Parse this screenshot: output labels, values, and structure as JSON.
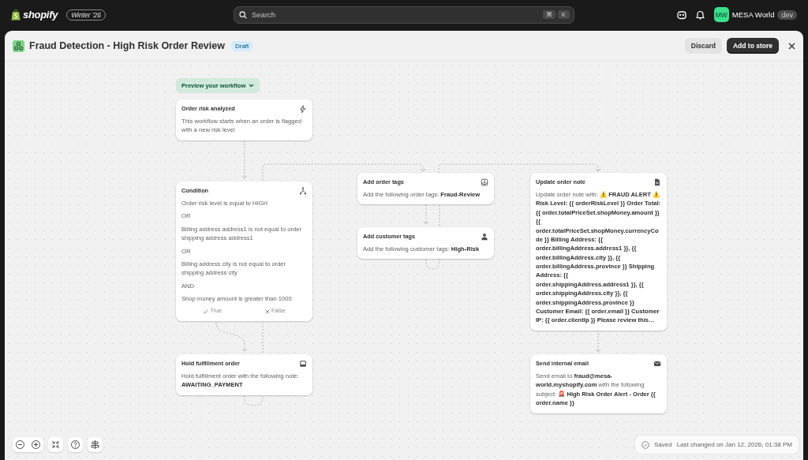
{
  "app": {
    "brand": "shopify",
    "edition": "Winter '26",
    "search": {
      "placeholder": "Search",
      "keys": [
        "⌘",
        "K"
      ]
    },
    "account": {
      "initials": "MW",
      "name": "MESA World",
      "badge": "dev"
    }
  },
  "workflow": {
    "title": "Fraud Detection - High Risk Order Review",
    "status": "Draft",
    "actions": [
      "Discard",
      "Add to store"
    ]
  },
  "canvas": {
    "preview_button": "Preview your workflow",
    "nodes": [
      {
        "kind": "trigger",
        "title": "Order risk analyzed",
        "text": "This workflow starts when an order is flagged with a new risk level"
      },
      {
        "kind": "condition",
        "title": "Condition",
        "lines": [
          "Order risk level is equal to HIGH",
          "OR",
          "Billing address address1 is not equal to order shipping address address1",
          "OR",
          "Billing address city is not equal to order shipping address city",
          "AND",
          "Shop money amount is greater than 1000"
        ],
        "branches": [
          "True",
          "False"
        ]
      },
      {
        "kind": "order-tags",
        "title": "Add order tags",
        "text": "Add the following order tags: **Fraud-Review**"
      },
      {
        "kind": "customer-tags",
        "title": "Add customer tags",
        "text": "Add the following customer tags: **High-Risk**"
      },
      {
        "kind": "order-note",
        "title": "Update order note",
        "text": "Update order note with: **⚠️ FRAUD ALERT ⚠️ Risk Level: {{ orderRiskLevel }} Order Total: {{ order.totalPriceSet.shopMoney.amount }} {{ order.totalPriceSet.shopMoney.currencyCode }} Billing Address: {{ order.billingAddress.address1 }}, {{ order.billingAddress.city }}, {{ order.billingAddress.province }} Shipping Address: {{ order.shippingAddress.address1 }}, {{ order.shippingAddress.city }}, {{ order.shippingAddress.province }} Customer Email: {{ order.email }} Customer IP: {{ order.clientIp }} Please review this…**"
      },
      {
        "kind": "hold",
        "title": "Hold fulfillment order",
        "text": "Hold fulfillment order with the following note: **AWAITING_PAYMENT**"
      },
      {
        "kind": "email",
        "title": "Send internal email",
        "text": "Send email to **fraud@mesa-world.myshopify.com** with the following subject: **🚨 High Risk Order Alert - Order {{ order.name }}**"
      }
    ]
  },
  "status_bar": {
    "state": "Saved",
    "last_changed": "Last changed on Jan 12, 2026, 01:38 PM"
  }
}
